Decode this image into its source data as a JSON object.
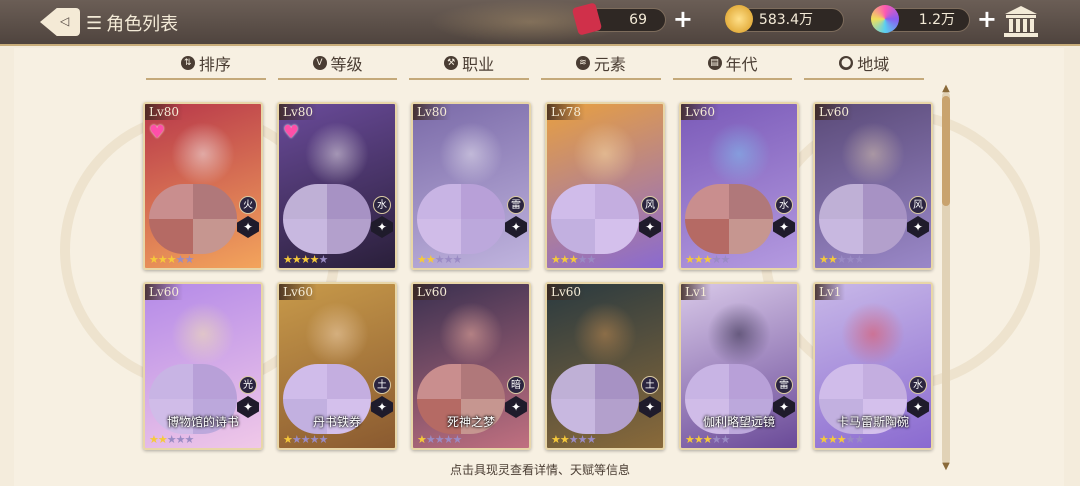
{
  "header": {
    "title": "角色列表",
    "back_label": "◁"
  },
  "resources": [
    {
      "name": "ticket",
      "value": "69",
      "color": "#d0304a"
    },
    {
      "name": "gold",
      "value": "583.4万",
      "color": "#e8b63a"
    },
    {
      "name": "crystal",
      "value": "1.2万",
      "color": "#b05ce8"
    }
  ],
  "sort_tabs": [
    {
      "label": "排序",
      "icon": "sort-icon",
      "glyph": "⇅"
    },
    {
      "label": "等级",
      "icon": "level-icon",
      "glyph": "V"
    },
    {
      "label": "职业",
      "icon": "class-icon",
      "glyph": "⚒"
    },
    {
      "label": "元素",
      "icon": "element-icon",
      "glyph": "≋"
    },
    {
      "label": "年代",
      "icon": "era-icon",
      "glyph": "▤"
    },
    {
      "label": "地域",
      "icon": "region-icon",
      "glyph": "⬤"
    }
  ],
  "cards": [
    {
      "lv": "Lv80",
      "name": "",
      "stars_on": 3,
      "favorite": true,
      "element": "火",
      "bg": [
        "#b8384a",
        "#f3a45c"
      ],
      "face": "#f2e8ea"
    },
    {
      "lv": "Lv80",
      "name": "",
      "stars_on": 4,
      "favorite": true,
      "element": "水",
      "bg": [
        "#6a4b9a",
        "#2a1f3a"
      ],
      "face": "#e6dfe6"
    },
    {
      "lv": "Lv80",
      "name": "",
      "stars_on": 2,
      "favorite": false,
      "element": "雷",
      "bg": [
        "#7a6aa8",
        "#c0b4de"
      ],
      "face": "#e8e4f0"
    },
    {
      "lv": "Lv78",
      "name": "",
      "stars_on": 3,
      "favorite": false,
      "element": "风",
      "bg": [
        "#e8a040",
        "#8a6ad0"
      ],
      "face": "#f6d9a8"
    },
    {
      "lv": "Lv60",
      "name": "",
      "stars_on": 3,
      "favorite": false,
      "element": "水",
      "bg": [
        "#7a5ab8",
        "#b49ae0"
      ],
      "face": "#7fc0f0"
    },
    {
      "lv": "Lv60",
      "name": "",
      "stars_on": 2,
      "favorite": false,
      "element": "风",
      "bg": [
        "#5a4a78",
        "#9a88c8"
      ],
      "face": "#d8c4b0"
    },
    {
      "lv": "Lv60",
      "name": "博物馆的诗书",
      "stars_on": 2,
      "favorite": false,
      "element": "光",
      "bg": [
        "#b48ae8",
        "#f0c8e8"
      ],
      "face": "#f3e4b0"
    },
    {
      "lv": "Lv60",
      "name": "丹书铁券",
      "stars_on": 1,
      "favorite": false,
      "element": "土",
      "bg": [
        "#c89a4a",
        "#8a5a30"
      ],
      "face": "#f0d2b0"
    },
    {
      "lv": "Lv60",
      "name": "死神之梦",
      "stars_on": 1,
      "favorite": false,
      "element": "暗",
      "bg": [
        "#3a3050",
        "#c07080"
      ],
      "face": "#f0b0a0"
    },
    {
      "lv": "Lv60",
      "name": "",
      "stars_on": 2,
      "favorite": false,
      "element": "土",
      "bg": [
        "#2a3a40",
        "#8a6a3a"
      ],
      "face": "#c08a50"
    },
    {
      "lv": "Lv1",
      "name": "伽利略望远镜",
      "stars_on": 3,
      "favorite": false,
      "element": "雷",
      "bg": [
        "#d8c8e8",
        "#6a4a98"
      ],
      "face": "#2a2440"
    },
    {
      "lv": "Lv1",
      "name": "卡马雷斯陶碗",
      "stars_on": 3,
      "favorite": false,
      "element": "水",
      "bg": [
        "#c8b8e8",
        "#8a6ad0"
      ],
      "face": "#e0505a"
    }
  ],
  "footer_hint": "点击具现灵查看详情、天赋等信息"
}
